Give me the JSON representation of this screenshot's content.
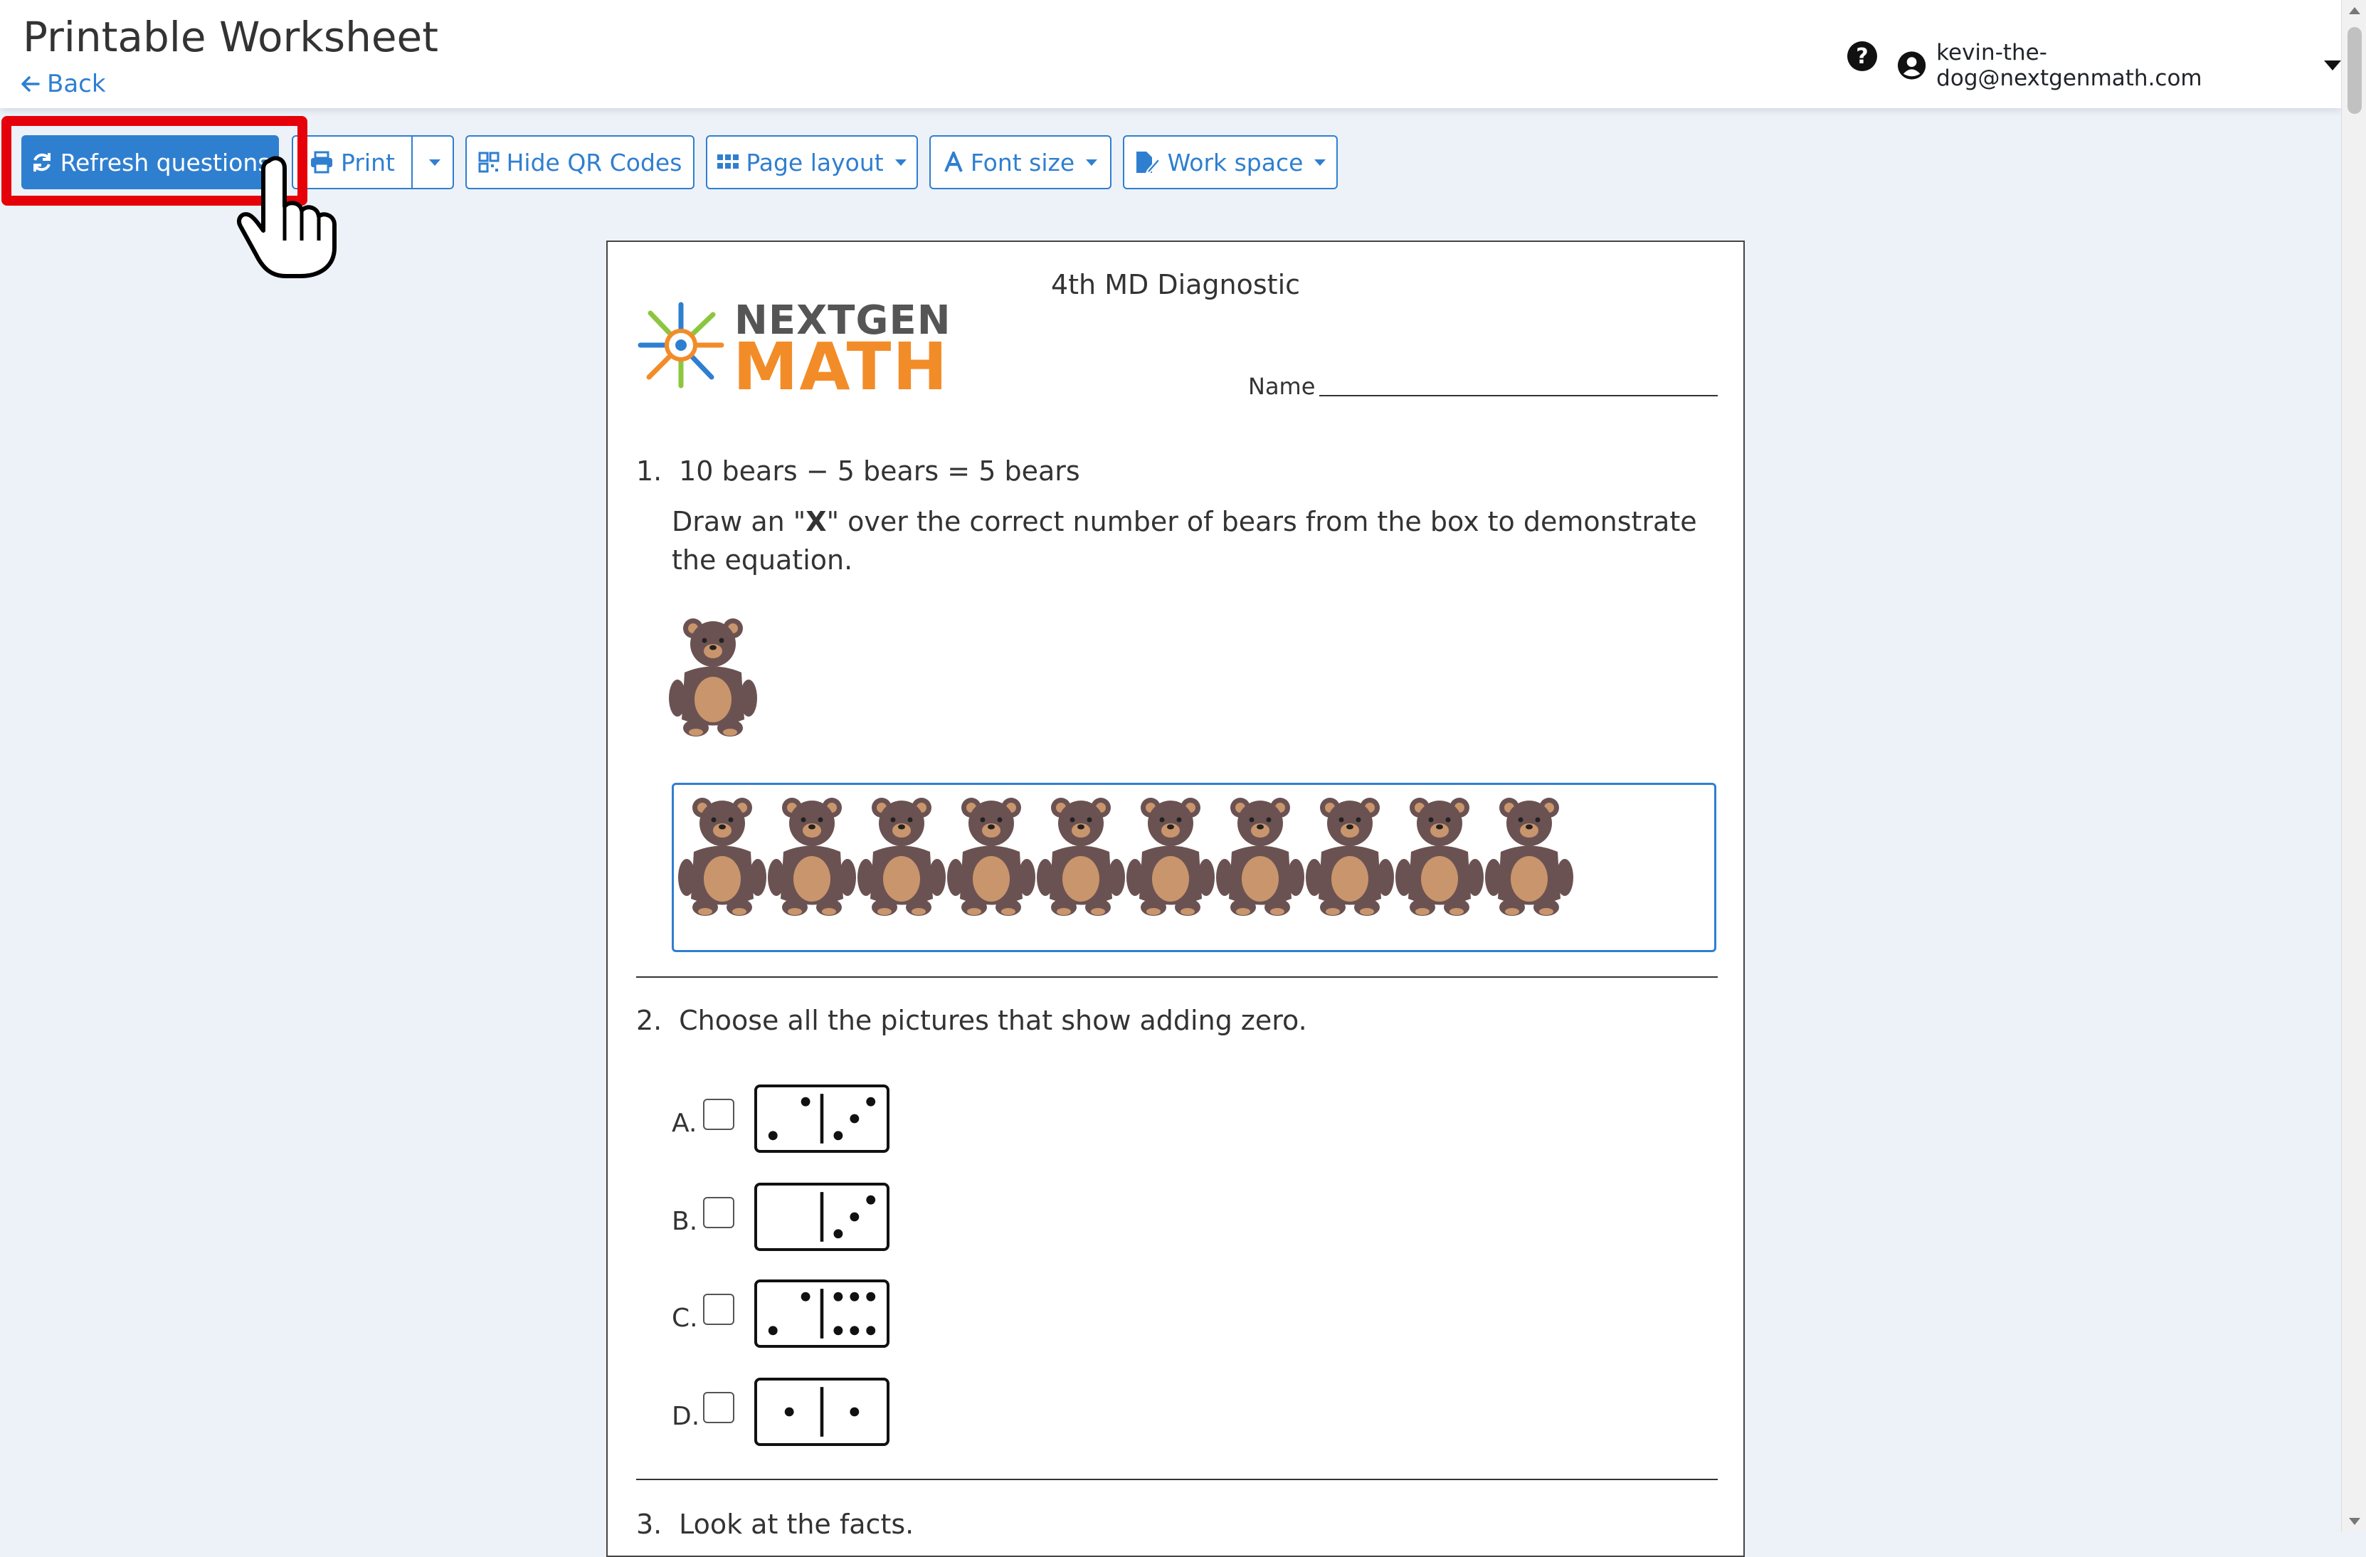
{
  "header": {
    "title": "Printable Worksheet",
    "back_label": "Back",
    "help_label": "?",
    "user_email": "kevin-the-dog@nextgenmath.com"
  },
  "toolbar": {
    "refresh_label": "Refresh questions",
    "print_label": "Print",
    "hide_qr_label": "Hide QR Codes",
    "page_layout_label": "Page layout",
    "font_size_label": "Font size",
    "work_space_label": "Work space"
  },
  "colors": {
    "accent": "#2f7fd0",
    "highlight": "#e5000a",
    "bear": "#6b5252",
    "bear_belly": "#c9956c"
  },
  "worksheet": {
    "title": "4th MD Diagnostic",
    "logo_top": "NEXTGEN",
    "logo_bottom": "MATH",
    "name_label": "Name",
    "q1": {
      "number": "1.",
      "text": "10 bears − 5 bears = 5 bears",
      "instr_pre": "Draw an \"",
      "instr_bold": "X",
      "instr_post": "\" over the correct number of bears from the box to demonstrate the equation.",
      "bear_count": 10
    },
    "q2": {
      "number": "2.",
      "text": "Choose all the pictures that show adding zero.",
      "options": [
        {
          "label": "A.",
          "left_dots": 2,
          "right_dots": 3
        },
        {
          "label": "B.",
          "left_dots": 0,
          "right_dots": 3
        },
        {
          "label": "C.",
          "left_dots": 2,
          "right_dots": 6
        },
        {
          "label": "D.",
          "left_dots": 1,
          "right_dots": 1
        }
      ]
    },
    "q3": {
      "number": "3.",
      "text": "Look at the facts."
    }
  }
}
